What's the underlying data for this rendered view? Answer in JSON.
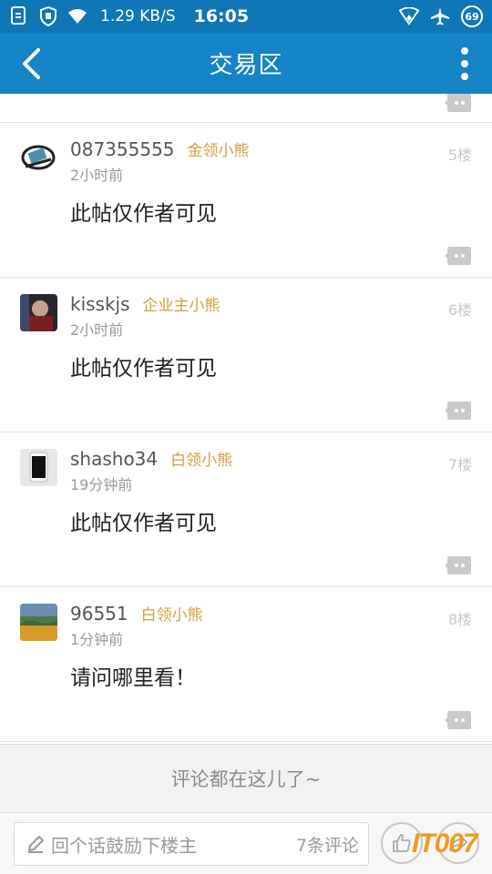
{
  "status_bar": {
    "speed": "1.29 KB/S",
    "time": "16:05",
    "battery": "69"
  },
  "header": {
    "title": "交易区"
  },
  "posts": [
    {
      "username": "087355555",
      "badge": "金领小熊",
      "time": "2小时前",
      "floor": "5楼",
      "content": "此帖仅作者可见"
    },
    {
      "username": "kisskjs",
      "badge": "企业主小熊",
      "time": "2小时前",
      "floor": "6楼",
      "content": "此帖仅作者可见"
    },
    {
      "username": "shasho34",
      "badge": "白领小熊",
      "time": "19分钟前",
      "floor": "7楼",
      "content": "此帖仅作者可见"
    },
    {
      "username": "96551",
      "badge": "白领小熊",
      "time": "1分钟前",
      "floor": "8楼",
      "content": "请问哪里看！"
    }
  ],
  "footer": {
    "hint": "评论都在这儿了~",
    "reply_placeholder": "回个话鼓励下楼主",
    "comment_count": "7条评论"
  },
  "watermark": "IT007",
  "colors": {
    "status_bar": "#0f77b6",
    "app_bar": "#1384c8",
    "badge": "#d4a03c"
  }
}
